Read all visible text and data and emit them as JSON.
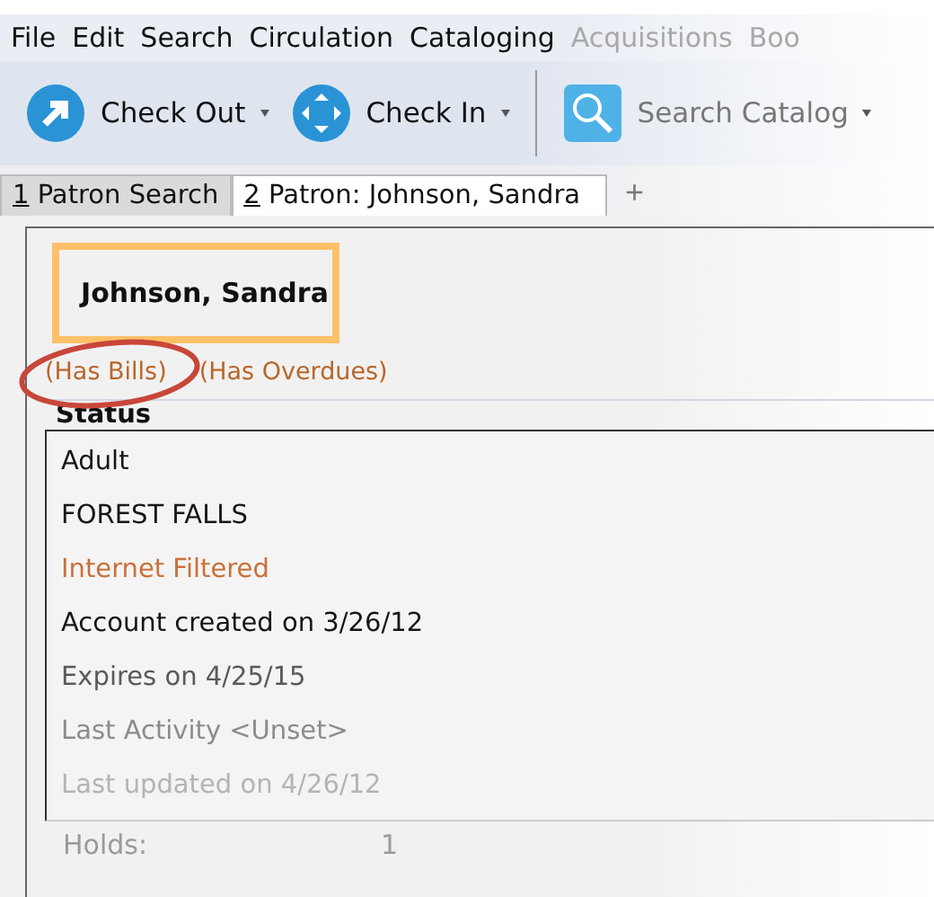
{
  "menu_bar": [
    {
      "label": "File",
      "disabled": false
    },
    {
      "label": "Edit",
      "disabled": false
    },
    {
      "label": "Search",
      "disabled": false
    },
    {
      "label": "Circulation",
      "disabled": false
    },
    {
      "label": "Cataloging",
      "disabled": false
    },
    {
      "label": "Acquisitions",
      "disabled": true
    },
    {
      "label": "Boo",
      "disabled": true
    }
  ],
  "toolbar": [
    {
      "label": "Check Out",
      "kind": "checkout"
    },
    {
      "label": "Check In",
      "kind": "checkin"
    },
    {
      "label": "Search Catalog",
      "kind": "search"
    }
  ],
  "tabs": [
    {
      "number": "1",
      "label": "Patron Search",
      "selected": false
    },
    {
      "number": "2",
      "label": "Patron: Johnson, Sandra",
      "selected": true
    }
  ],
  "new_tab": "+",
  "patron": {
    "name": "Johnson, Sandra",
    "alerts": [
      {
        "text": "(Has Bills)",
        "circled": true
      },
      {
        "text": "(Has Overdues)",
        "circled": false
      }
    ]
  },
  "status": {
    "title": "Status",
    "lines": [
      {
        "text": "Adult",
        "kind": "normal"
      },
      {
        "text": "FOREST FALLS",
        "kind": "normal"
      },
      {
        "text": "Internet Filtered",
        "kind": "alert"
      },
      {
        "text": "Account created on 3/26/12",
        "kind": "normal"
      },
      {
        "text": "Expires on 4/25/15",
        "kind": "dim"
      },
      {
        "text": "Last Activity <Unset>",
        "kind": "faint"
      },
      {
        "text": "Last updated on 4/26/12",
        "kind": "fainter"
      }
    ]
  },
  "holds": {
    "label": "Holds:",
    "value": "1"
  }
}
